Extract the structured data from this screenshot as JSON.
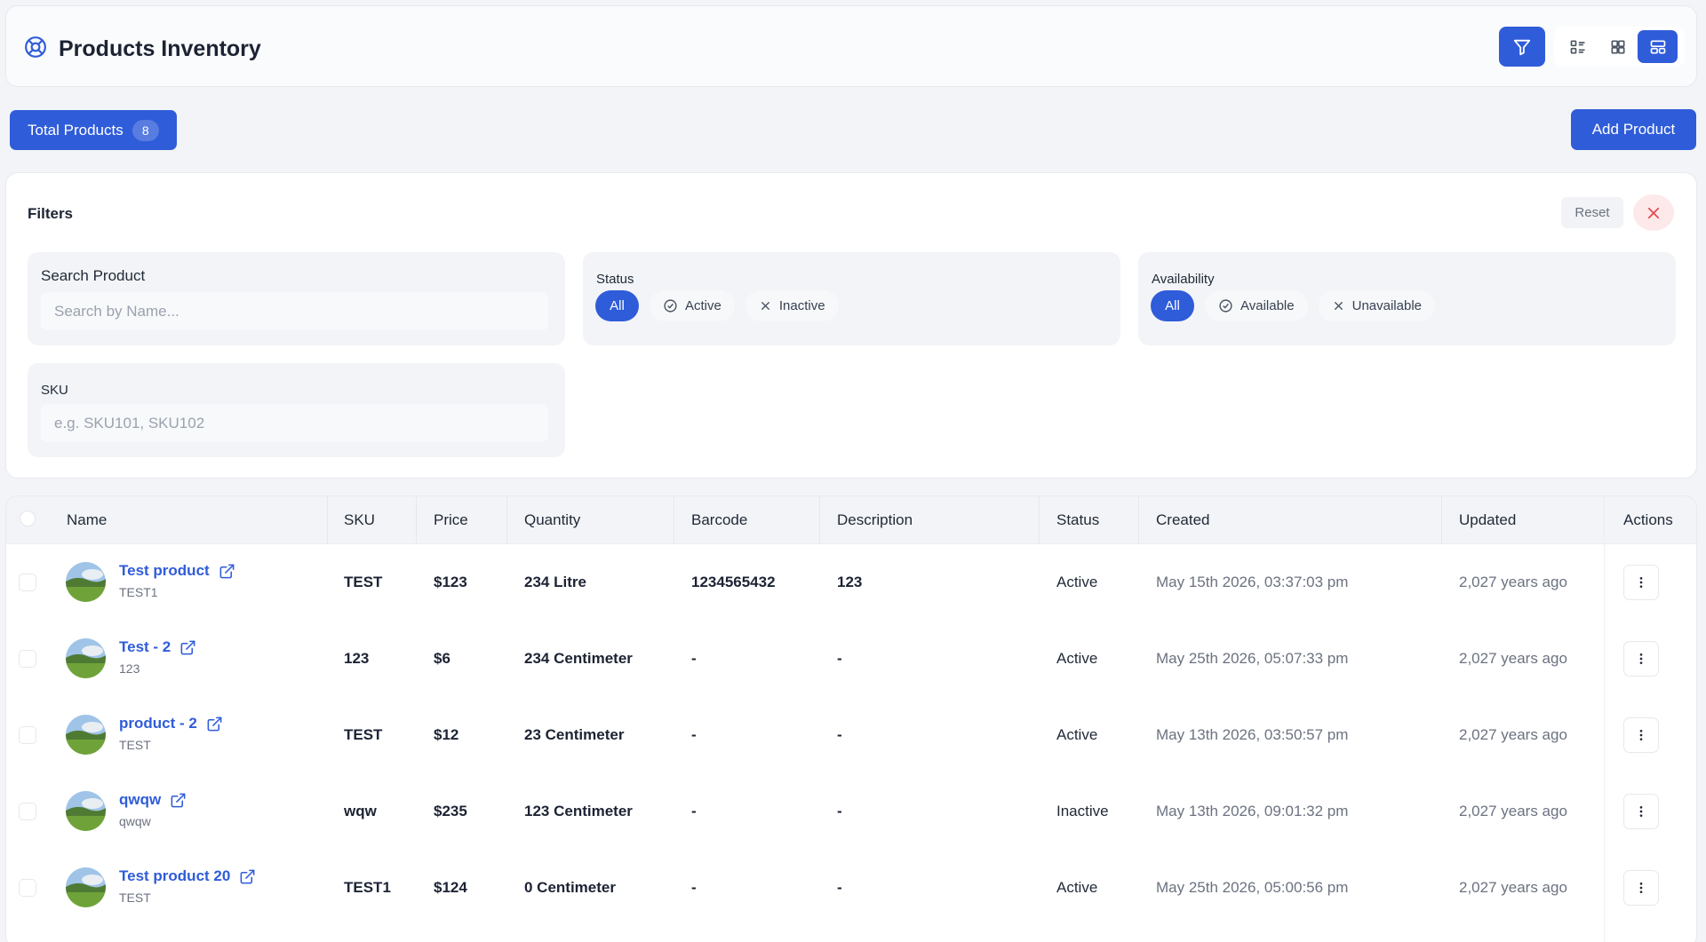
{
  "header": {
    "title": "Products Inventory"
  },
  "toolbar": {
    "total_label": "Total Products",
    "total_count": "8",
    "add_label": "Add Product"
  },
  "filters": {
    "title": "Filters",
    "reset_label": "Reset",
    "search": {
      "label": "Search Product",
      "placeholder": "Search by Name..."
    },
    "status": {
      "label": "Status",
      "options": [
        "All",
        "Active",
        "Inactive"
      ],
      "selected": "All"
    },
    "availability": {
      "label": "Availability",
      "options": [
        "All",
        "Available",
        "Unavailable"
      ],
      "selected": "All"
    },
    "sku": {
      "label": "SKU",
      "placeholder": "e.g. SKU101, SKU102"
    }
  },
  "table": {
    "columns": [
      "Name",
      "SKU",
      "Price",
      "Quantity",
      "Barcode",
      "Description",
      "Status",
      "Created",
      "Updated",
      "Actions"
    ],
    "rows": [
      {
        "name": "Test product",
        "sub": "TEST1",
        "sku": "TEST",
        "price": "$123",
        "quantity": "234 Litre",
        "barcode": "1234565432",
        "description": "123",
        "status": "Active",
        "created": "May 15th 2026, 03:37:03 pm",
        "updated": "2,027 years ago"
      },
      {
        "name": "Test - 2",
        "sub": "123",
        "sku": "123",
        "price": "$6",
        "quantity": "234 Centimeter",
        "barcode": "-",
        "description": "-",
        "status": "Active",
        "created": "May 25th 2026, 05:07:33 pm",
        "updated": "2,027 years ago"
      },
      {
        "name": "product - 2",
        "sub": "TEST",
        "sku": "TEST",
        "price": "$12",
        "quantity": "23 Centimeter",
        "barcode": "-",
        "description": "-",
        "status": "Active",
        "created": "May 13th 2026, 03:50:57 pm",
        "updated": "2,027 years ago"
      },
      {
        "name": "qwqw",
        "sub": "qwqw",
        "sku": "wqw",
        "price": "$235",
        "quantity": "123 Centimeter",
        "barcode": "-",
        "description": "-",
        "status": "Inactive",
        "created": "May 13th 2026, 09:01:32 pm",
        "updated": "2,027 years ago"
      },
      {
        "name": "Test product 20",
        "sub": "TEST",
        "sku": "TEST1",
        "price": "$124",
        "quantity": "0 Centimeter",
        "barcode": "-",
        "description": "-",
        "status": "Active",
        "created": "May 25th 2026, 05:00:56 pm",
        "updated": "2,027 years ago"
      }
    ]
  },
  "colors": {
    "accent": "#2f5cd9",
    "danger": "#e5484d"
  },
  "icons": [
    "lifebuoy-icon",
    "filter-icon",
    "list-view-icon",
    "grid-view-icon",
    "card-view-icon",
    "close-icon",
    "check-circle-icon",
    "x-icon",
    "external-link-icon",
    "more-vertical-icon"
  ]
}
